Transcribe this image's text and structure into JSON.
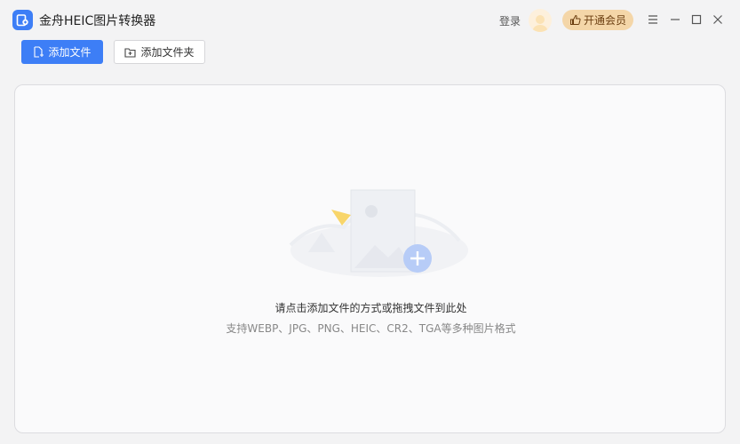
{
  "app": {
    "title": "金舟HEIC图片转换器",
    "accent_color": "#3d7ef6",
    "logo_icon": "document-logo-icon"
  },
  "header": {
    "login_label": "登录",
    "vip_label": "开通会员",
    "vip_icon": "thumbs-up-icon",
    "window_controls": [
      "menu-icon",
      "minimize-icon",
      "maximize-icon",
      "close-icon"
    ]
  },
  "toolbar": {
    "add_file_label": "添加文件",
    "add_folder_label": "添加文件夹"
  },
  "dropzone": {
    "hint_primary": "请点击添加文件的方式或拖拽文件到此处",
    "hint_secondary": "支持WEBP、JPG、PNG、HEIC、CR2、TGA等多种图片格式"
  }
}
